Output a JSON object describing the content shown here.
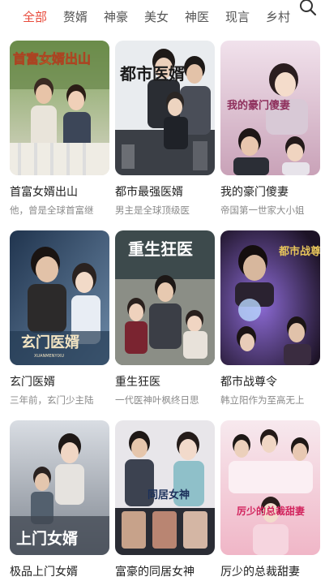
{
  "tabs": [
    "全部",
    "赘婿",
    "神豪",
    "美女",
    "神医",
    "现言",
    "乡村"
  ],
  "active_tab": "全部",
  "accent_color": "#e84b3c",
  "search_icon": "search-icon",
  "dramas": [
    {
      "title": "首富女婿出山",
      "desc": "他，曾是全球首富继",
      "poster_text": "首富女婿出山"
    },
    {
      "title": "都市最强医婿",
      "desc": "男主是全球顶级医",
      "poster_text": "都市医婿"
    },
    {
      "title": "我的豪门傻妻",
      "desc": "帝国第一世家大小姐",
      "poster_text": "我的豪门傻妻"
    },
    {
      "title": "玄门医婿",
      "desc": "三年前，玄门少主陆",
      "poster_text": "玄门医婿",
      "poster_sub": "XUANMENYIXU"
    },
    {
      "title": "重生狂医",
      "desc": "一代医神叶枫终日思",
      "poster_text": "重生狂医"
    },
    {
      "title": "都市战尊令",
      "desc": "韩立阳作为至高无上",
      "poster_text": "都市战尊令"
    },
    {
      "title": "极品上门女婿",
      "desc": "",
      "poster_text": "上门女婿"
    },
    {
      "title": "富豪的同居女神",
      "desc": "",
      "poster_text": "同居女神"
    },
    {
      "title": "厉少的总裁甜妻",
      "desc": "",
      "poster_text": "厉少的总裁甜妻"
    }
  ]
}
